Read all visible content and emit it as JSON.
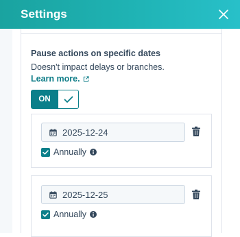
{
  "header": {
    "title": "Settings",
    "close_icon": "close-icon"
  },
  "section": {
    "title": "Pause actions on specific dates",
    "description": "Doesn't impact delays or branches.",
    "learn_more": "Learn more.",
    "learn_more_icon": "external-link-icon"
  },
  "toggle": {
    "label": "ON",
    "state": true
  },
  "dates": [
    {
      "value": "2025-12-24",
      "annually_label": "Annually",
      "annually_checked": true
    },
    {
      "value": "2025-12-25",
      "annually_label": "Annually",
      "annually_checked": true
    }
  ],
  "colors": {
    "header_gradient_start": "#1aa3a0",
    "header_gradient_end": "#28c0c9",
    "accent": "#0b7f8a",
    "link": "#0f7d88",
    "text": "#33475b",
    "border": "#dfe3eb"
  }
}
